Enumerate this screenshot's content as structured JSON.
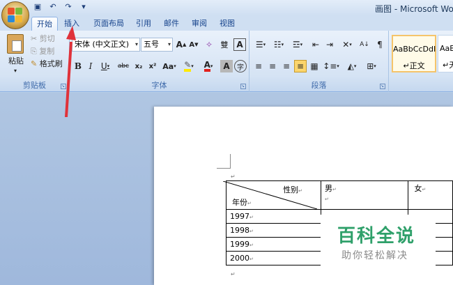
{
  "window": {
    "title": "画图 - Microsoft Wor"
  },
  "tabs": [
    "开始",
    "插入",
    "页面布局",
    "引用",
    "邮件",
    "审阅",
    "视图"
  ],
  "clipboard": {
    "paste": "粘贴",
    "cut": "剪切",
    "copy": "复制",
    "format_painter": "格式刷",
    "label": "剪贴板"
  },
  "font": {
    "name": "宋体 (中文正文)",
    "size": "五号",
    "label": "字体",
    "bold": "B",
    "italic": "I",
    "underline": "U",
    "strike": "abc",
    "subscript": "x₂",
    "superscript": "x²",
    "case": "Aa",
    "grow": "A",
    "shrink": "A",
    "char_border": "A",
    "enclose": "字"
  },
  "paragraph": {
    "label": "段落"
  },
  "styles": [
    {
      "sample": "AaBbCcDdI",
      "name": "正文"
    },
    {
      "sample": "AaBb",
      "name": "无"
    }
  ],
  "table": {
    "header_top": "性别",
    "header_bottom": "年份",
    "male": "男",
    "female": "女",
    "years": [
      "1997",
      "1998",
      "1999",
      "2000"
    ]
  },
  "watermark": {
    "main": "百科全说",
    "sub": "助你轻松解决"
  },
  "colors": {
    "arrow": "#e0323a",
    "watermark_green": "#2fa06a",
    "ribbon_bg": "#dbe7f6"
  }
}
